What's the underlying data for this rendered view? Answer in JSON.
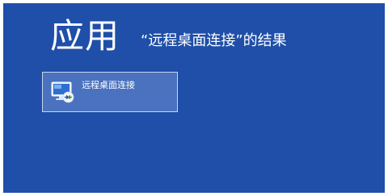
{
  "header": {
    "title": "应用",
    "query_text": "“远程桌面连接”的结果"
  },
  "results": [
    {
      "label": "远程桌面连接",
      "icon": "remote-desktop-icon"
    }
  ],
  "colors": {
    "background": "#1f4fa8",
    "tile_selected": "#4a72be",
    "tile_border": "#c8d6f0",
    "text": "#ffffff"
  }
}
